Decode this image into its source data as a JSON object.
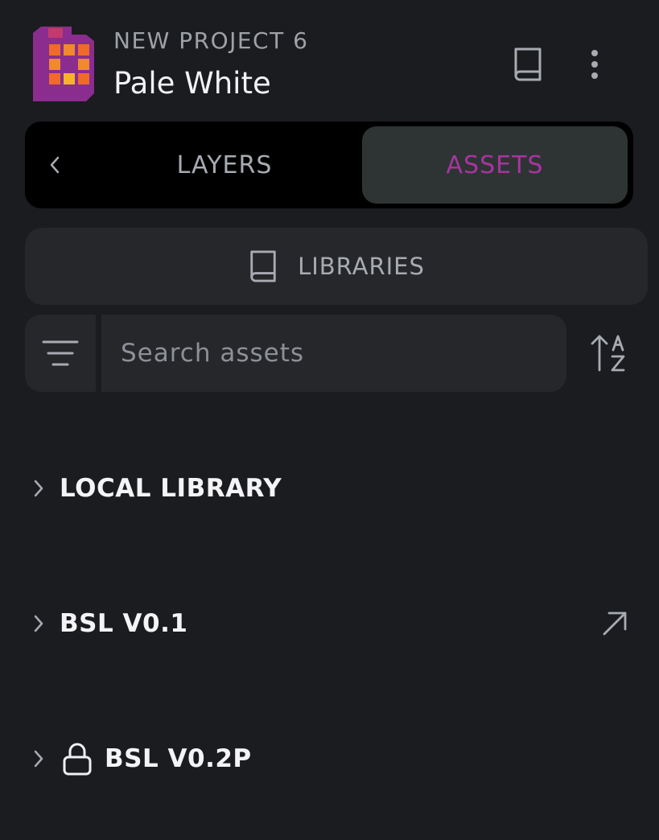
{
  "header": {
    "project_name": "NEW PROJECT 6",
    "file_name": "Pale White",
    "icons": [
      "app-logo",
      "book-icon",
      "more-vertical-icon"
    ]
  },
  "tabs": {
    "back_icon": "chevron-left-icon",
    "items": [
      {
        "label": "LAYERS",
        "active": false
      },
      {
        "label": "ASSETS",
        "active": true
      }
    ]
  },
  "libraries_button": {
    "label": "LIBRARIES",
    "icon": "book-icon"
  },
  "search": {
    "value": "",
    "placeholder": "Search assets",
    "filter_icon": "filter-icon",
    "sort_icon": "sort-a-z-icon"
  },
  "libraries": [
    {
      "label": "LOCAL LIBRARY",
      "expanded": false
    },
    {
      "label": "BSL V0.1",
      "expanded": false,
      "external_link": true
    },
    {
      "label": "BSL V0.2P",
      "expanded": false,
      "locked": true
    }
  ],
  "colors": {
    "background": "#1b1c1f",
    "accent": "#a6359e",
    "panel": "#26272b",
    "active_tab": "#2e3434",
    "muted_text": "#a8abb2"
  }
}
